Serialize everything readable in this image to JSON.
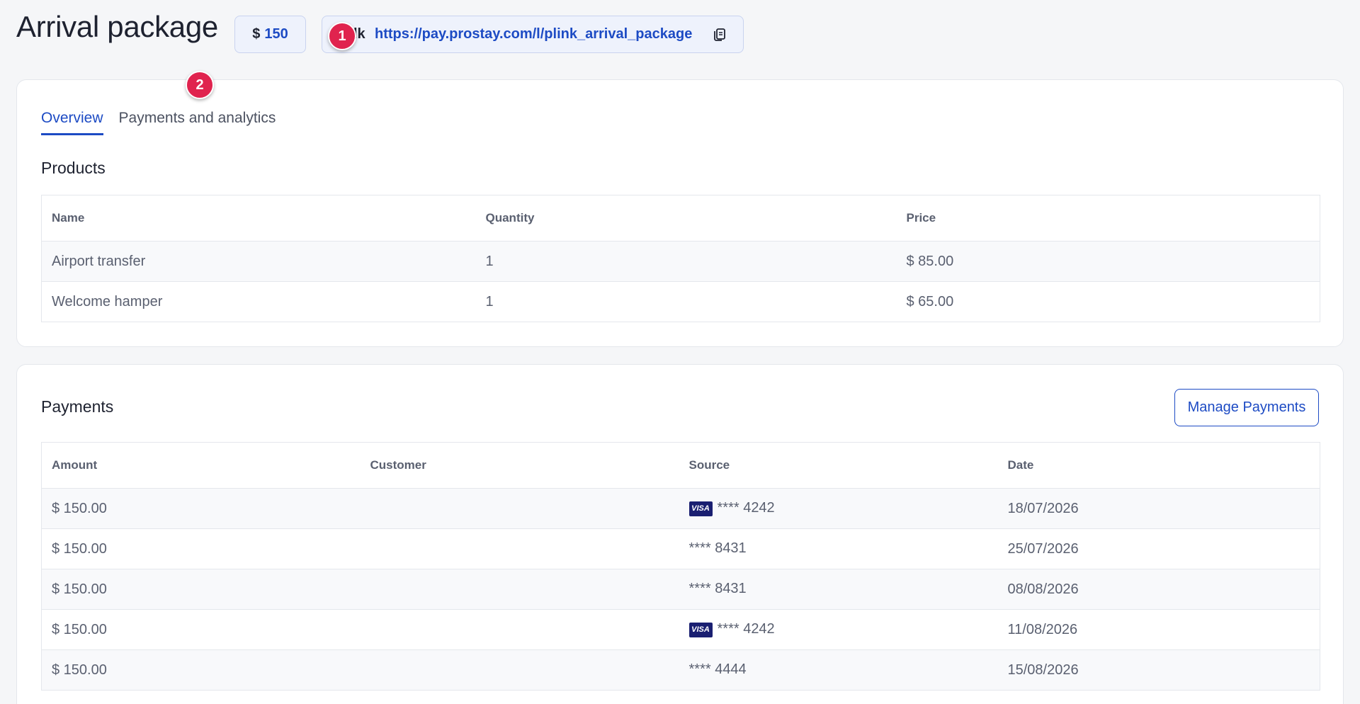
{
  "header": {
    "title": "Arrival package",
    "price_currency": "$",
    "price_amount": "150",
    "link_prefix": "lk",
    "link_url": "https://pay.prostay.com/l/plink_arrival_package",
    "copy_icon": "copy-icon"
  },
  "badges": [
    "1",
    "2"
  ],
  "tabs": [
    {
      "label": "Overview",
      "active": true
    },
    {
      "label": "Payments and analytics",
      "active": false
    }
  ],
  "products": {
    "title": "Products",
    "columns": [
      "Name",
      "Quantity",
      "Price"
    ],
    "rows": [
      {
        "name": "Airport transfer",
        "quantity": "1",
        "price": "$ 85.00"
      },
      {
        "name": "Welcome hamper",
        "quantity": "1",
        "price": "$ 65.00"
      }
    ]
  },
  "payments": {
    "title": "Payments",
    "manage_label": "Manage Payments",
    "columns": [
      "Amount",
      "Customer",
      "Source",
      "Date"
    ],
    "rows": [
      {
        "amount": "$ 150.00",
        "customer": "",
        "card_brand": "VISA",
        "source": "**** 4242",
        "date": "18/07/2026"
      },
      {
        "amount": "$ 150.00",
        "customer": "",
        "card_brand": "",
        "source": "**** 8431",
        "date": "25/07/2026"
      },
      {
        "amount": "$ 150.00",
        "customer": "",
        "card_brand": "",
        "source": "**** 8431",
        "date": "08/08/2026"
      },
      {
        "amount": "$ 150.00",
        "customer": "",
        "card_brand": "VISA",
        "source": "**** 4242",
        "date": "11/08/2026"
      },
      {
        "amount": "$ 150.00",
        "customer": "",
        "card_brand": "",
        "source": "**** 4444",
        "date": "15/08/2026"
      }
    ]
  },
  "colors": {
    "accent": "#1d4bc4",
    "badge": "#e0234e",
    "visa": "#1a1f71"
  }
}
